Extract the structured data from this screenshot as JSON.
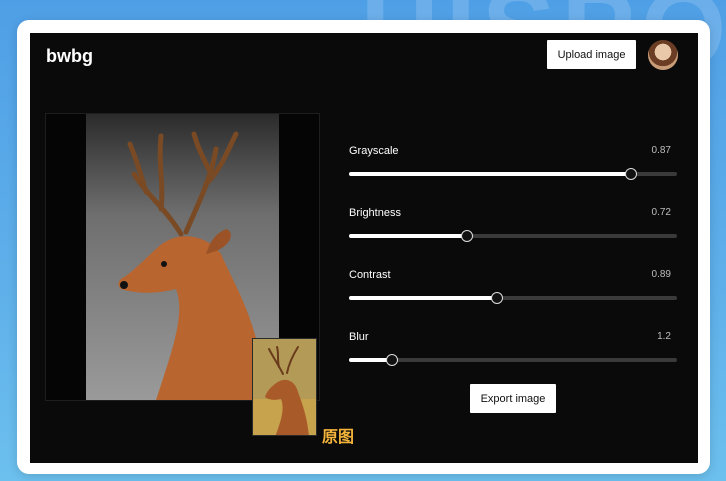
{
  "background": {
    "watermark": "HISPO"
  },
  "header": {
    "brand": "bwbg",
    "upload_label": "Upload image"
  },
  "sliders": [
    {
      "label": "Grayscale",
      "value": "0.87",
      "fraction": 0.86
    },
    {
      "label": "Brightness",
      "value": "0.72",
      "fraction": 0.36
    },
    {
      "label": "Contrast",
      "value": "0.89",
      "fraction": 0.45
    },
    {
      "label": "Blur",
      "value": "1.2",
      "fraction": 0.13
    }
  ],
  "export_label": "Export image",
  "thumbnail_label": "原图",
  "colors": {
    "accent_label": "#f5b43a",
    "app_bg": "#0a0a0a",
    "track": "#3a3a3a"
  }
}
